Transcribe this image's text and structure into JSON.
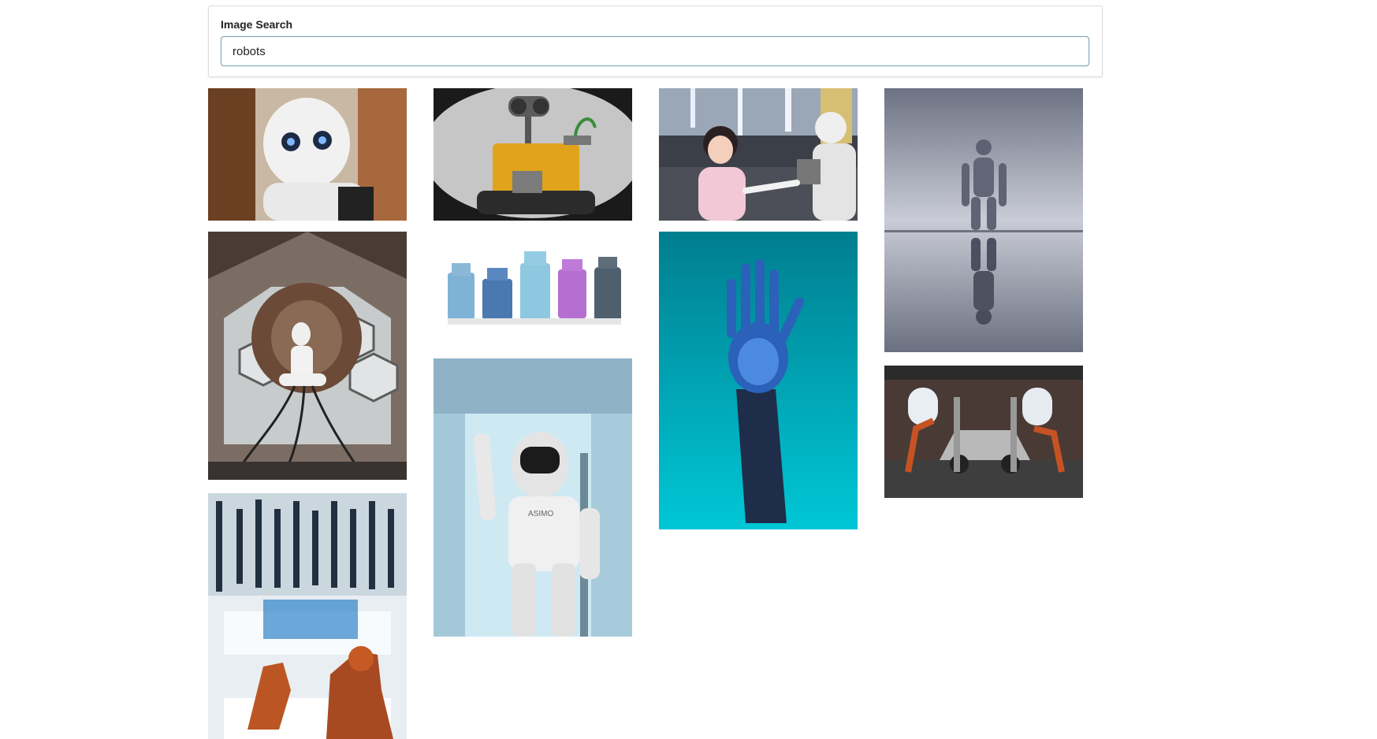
{
  "search": {
    "label": "Image Search",
    "value": "robots"
  },
  "results": [
    {
      "name": "pepper-robot-closeup"
    },
    {
      "name": "walle-lego-robot"
    },
    {
      "name": "girl-with-pepper-robot"
    },
    {
      "name": "humanoid-reflection"
    },
    {
      "name": "mannequin-hexagon-room"
    },
    {
      "name": "tin-toy-robots"
    },
    {
      "name": "robotic-blue-hand"
    },
    {
      "name": "car-factory-robots"
    },
    {
      "name": "lab-robot-arms"
    },
    {
      "name": "asimo-robot-waving"
    }
  ]
}
